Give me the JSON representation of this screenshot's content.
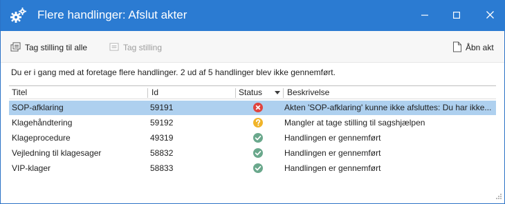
{
  "window": {
    "title": "Flere handlinger: Afslut akter",
    "accent_color": "#2b7bd2",
    "icons": {
      "app": "gears-icon",
      "minimize": "minimize-icon",
      "maximize": "maximize-icon",
      "close": "close-icon"
    }
  },
  "toolbar": {
    "take_all_label": "Tag stilling til alle",
    "take_label": "Tag stilling",
    "open_label": "Åbn akt",
    "take_enabled": false
  },
  "info_text": "Du er i gang med at foretage flere handlinger. 2 ud af 5 handlinger blev ikke gennemført.",
  "grid": {
    "columns": {
      "title": "Titel",
      "id": "Id",
      "status": "Status",
      "description": "Beskrivelse"
    },
    "rows": [
      {
        "title": "SOP-afklaring",
        "id": "59191",
        "status": "error",
        "description": "Akten 'SOP-afklaring' kunne ikke afsluttes: Du har ikke...",
        "selected": true
      },
      {
        "title": "Klagehåndtering",
        "id": "59192",
        "status": "question",
        "description": "Mangler at tage stilling til sagshjælpen",
        "selected": false
      },
      {
        "title": "Klageprocedure",
        "id": "49319",
        "status": "success",
        "description": "Handlingen er gennemført",
        "selected": false
      },
      {
        "title": "Vejledning til klagesager",
        "id": "58832",
        "status": "success",
        "description": "Handlingen er gennemført",
        "selected": false
      },
      {
        "title": "VIP-klager",
        "id": "58833",
        "status": "success",
        "description": "Handlingen er gennemført",
        "selected": false
      }
    ],
    "status_colors": {
      "error": "#e0443e",
      "question": "#f0b429",
      "success": "#6aa88c"
    }
  }
}
